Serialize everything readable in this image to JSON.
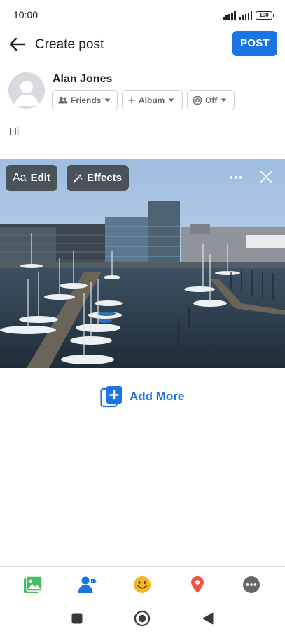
{
  "status": {
    "time": "10:00",
    "battery": "100"
  },
  "header": {
    "title": "Create post",
    "post_label": "POST"
  },
  "user": {
    "name": "Alan Jones"
  },
  "chips": {
    "audience": "Friends",
    "album": "Album",
    "instagram": "Off"
  },
  "post": {
    "text": "Hi"
  },
  "photo": {
    "edit_label": "Edit",
    "effects_label": "Effects",
    "edit_icon_text": "Aa"
  },
  "add_more": {
    "label": "Add More"
  },
  "bottom_bar": {
    "icons": [
      "photo-icon",
      "tag-people-icon",
      "feeling-icon",
      "location-icon",
      "more-icon"
    ]
  },
  "colors": {
    "accent": "#1b74e4",
    "photo_green": "#45bd62",
    "feeling_yellow": "#f7b928",
    "location_red": "#f5533d",
    "more_gray": "#65676b"
  }
}
